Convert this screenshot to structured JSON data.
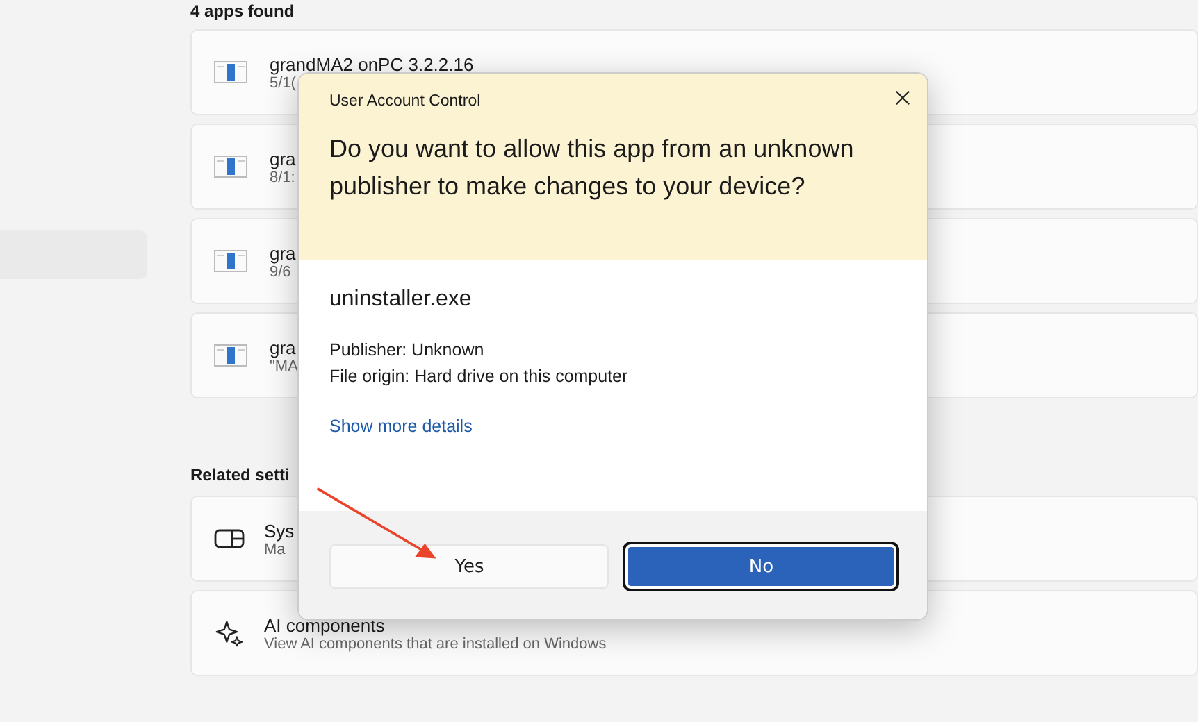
{
  "settings": {
    "heading": "4 apps found",
    "apps": [
      {
        "name": "grandMA2 onPC 3.2.2.16",
        "detail": "5/1("
      },
      {
        "name": "gra",
        "detail": "8/1:"
      },
      {
        "name": "gra",
        "detail": "9/6"
      },
      {
        "name": "gra",
        "detail": "\"MA"
      }
    ],
    "related_heading": "Related setti",
    "related": [
      {
        "kind": "system",
        "title": "Sys",
        "subtitle": "Ma"
      },
      {
        "kind": "ai",
        "title": "AI components",
        "subtitle": "View AI components that are installed on Windows"
      }
    ]
  },
  "dialog": {
    "title": "User Account Control",
    "question": "Do you want to allow this app from an unknown publisher to make changes to your device?",
    "program": "uninstaller.exe",
    "details": [
      "Publisher: Unknown",
      "File origin: Hard drive on this computer"
    ],
    "link": "Show more details",
    "buttons": [
      {
        "label": "Yes",
        "kind": "secondary"
      },
      {
        "label": "No",
        "kind": "primary"
      }
    ]
  }
}
